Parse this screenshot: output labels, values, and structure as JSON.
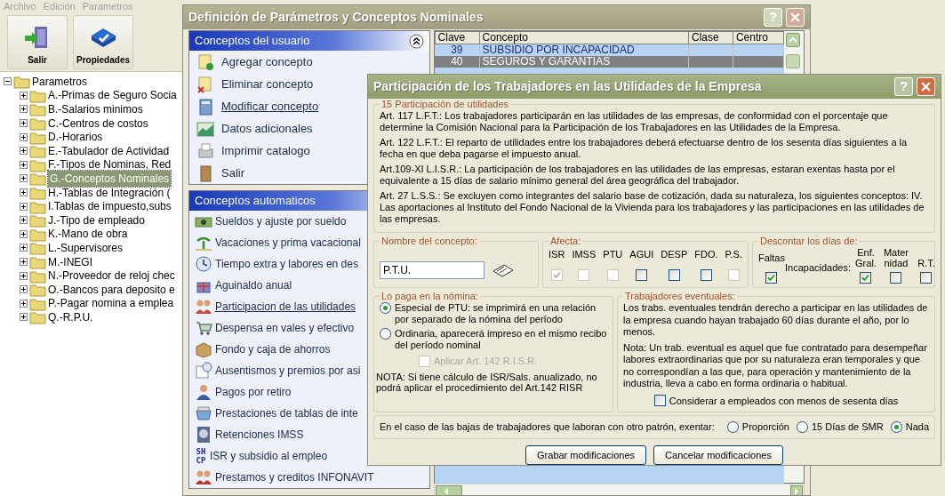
{
  "app": {
    "menu": [
      "Archivo",
      "Edición",
      "Parametros"
    ],
    "toolbar": [
      {
        "label": "Salir"
      },
      {
        "label": "Propiedades"
      }
    ],
    "tree": {
      "label": "Parametros",
      "expanded": true,
      "children": [
        {
          "label": "A.-Primas de Seguro Socia",
          "selected": false
        },
        {
          "label": "B.-Salarios minimos",
          "selected": false
        },
        {
          "label": "C.-Centros de costos",
          "selected": false
        },
        {
          "label": "D.-Horarios",
          "selected": false
        },
        {
          "label": "E.-Tabulador de Actividad",
          "selected": false
        },
        {
          "label": "F.-Tipos de Nominas, Red",
          "selected": false
        },
        {
          "label": "G.-Conceptos Nominales",
          "selected": true
        },
        {
          "label": "H.-Tablas de Integración (",
          "selected": false
        },
        {
          "label": "I.Tablas de impuesto,subs",
          "selected": false
        },
        {
          "label": "J.-Tipo de empleado",
          "selected": false
        },
        {
          "label": "K.-Mano de obra",
          "selected": false
        },
        {
          "label": "L.-Supervisores",
          "selected": false
        },
        {
          "label": "M.-INEGI",
          "selected": false
        },
        {
          "label": "N.-Proveedor de reloj chec",
          "selected": false
        },
        {
          "label": "O.-Bancos para deposito e",
          "selected": false
        },
        {
          "label": "P.-Pagar nomina a emplea",
          "selected": false
        },
        {
          "label": "Q.-R.P.U.",
          "selected": false
        }
      ]
    }
  },
  "back_window": {
    "title": "Definición de Parámetros y Conceptos Nominales",
    "help": "?",
    "user_panel": {
      "title": "Conceptos del usuario",
      "items": [
        {
          "label": "Agregar concepto",
          "hover": false
        },
        {
          "label": "Eliminar concepto",
          "hover": false
        },
        {
          "label": "Modificar concepto",
          "hover": true
        },
        {
          "label": "Datos adicionales",
          "hover": false
        },
        {
          "label": "Imprimir catalogo",
          "hover": false
        },
        {
          "label": "Salir",
          "hover": false
        }
      ]
    },
    "auto_panel": {
      "title": "Conceptos automaticos",
      "items": [
        {
          "label": "Sueldos y ajuste por sueldo",
          "hover": false
        },
        {
          "label": "Vacaciones y prima vacacional",
          "hover": false
        },
        {
          "label": "Tiempo extra y labores en des",
          "hover": false
        },
        {
          "label": "Aguinaldo anual",
          "hover": false
        },
        {
          "label": "Participacion de las utilidades",
          "hover": true
        },
        {
          "label": "Despensa en vales y efectivo",
          "hover": false
        },
        {
          "label": "Fondo y caja de ahorros",
          "hover": false
        },
        {
          "label": "Ausentismos y premios por asi",
          "hover": false
        },
        {
          "label": "Pagos por retiro",
          "hover": false
        },
        {
          "label": "Prestaciones de tablas de inte",
          "hover": false
        },
        {
          "label": "Retenciones IMSS",
          "hover": false
        },
        {
          "label": "ISR y subsidio al empleo",
          "hover": false,
          "icon_text": "SH CP"
        },
        {
          "label": "Prestamos y creditos INFONAVIT",
          "hover": false
        }
      ]
    },
    "grid": {
      "columns": [
        "Clave",
        "Concepto",
        "Clase",
        "Centro"
      ],
      "rows": [
        {
          "cells": [
            "39",
            "SUBSIDIO POR INCAPACIDAD",
            "",
            ""
          ],
          "selected": false
        },
        {
          "cells": [
            "40",
            "SEGUROS Y GARANTIAS",
            "",
            ""
          ],
          "selected": true
        }
      ]
    }
  },
  "dialog": {
    "title": "Participación de los Trabajadores en las Utilidades de la Empresa",
    "help": "?",
    "info": {
      "legend": "15 Participación de utilidades",
      "paragraphs": [
        "Art. 117 L.F.T.: Los trabajadores participarán en las utilidades de las empresas, de conformidad con el porcentaje que determine la Comisión Nacional para la Participación de los Trabajadores en las Utilidades de la Empresa.",
        "Art. 122 L.F.T.: El reparto de utilidades entre los trabajadores deberá efectuarse dentro de los sesenta días siguientes a la fecha en que deba pagarse el impuesto anual.",
        "Art.109-XI L.I.S.R.: La participación de los trabajadores en las utilidades de las empresas, estaran exentas hasta por el equivalente a 15 días de salario mínimo general del área geográfica del trabajador.",
        "Art. 27 L.S.S.: Se excluyen como integrantes del salario base de cotización, dada su naturaleza, los siguientes conceptos: IV. Las aportaciones al Instituto del Fondo Nacional de la Vivienda para los trabajadores y las participaciones en las utilidades de las empresas."
      ]
    },
    "name_group": {
      "legend": "Nombre del concepto:",
      "value": "P.T.U."
    },
    "afecta": {
      "legend": "Afecta:",
      "items": [
        {
          "label": "ISR",
          "checked": true,
          "disabled": true
        },
        {
          "label": "IMSS",
          "checked": false,
          "disabled": true
        },
        {
          "label": "PTU",
          "checked": false,
          "disabled": true
        },
        {
          "label": "AGUI",
          "checked": false,
          "disabled": false
        },
        {
          "label": "DESP",
          "checked": false,
          "disabled": false
        },
        {
          "label": "FDO.",
          "checked": false,
          "disabled": false
        },
        {
          "label": "P.S.",
          "checked": false,
          "disabled": true
        }
      ]
    },
    "descontar": {
      "legend": "Descontar los días de:",
      "faltas": {
        "label": "Faltas",
        "checked": true
      },
      "incapacidades": "Incapacidades:",
      "items": [
        {
          "label": "Enf. Gral.",
          "checked": true
        },
        {
          "label": "Mater nidad",
          "checked": false
        },
        {
          "label": "R.T.",
          "checked": false
        }
      ]
    },
    "paga": {
      "legend": "Lo paga en la nómina:",
      "options": [
        {
          "label": "Especial de PTU: se imprimirá en una relación por separado de la nómina del período",
          "selected": true
        },
        {
          "label": "Ordinaria, aparecerá impreso en el mismo recibo del período nominal",
          "selected": false
        }
      ],
      "aplicar": {
        "label": "Aplicar Art. 142 R.I.S.R.",
        "checked": false,
        "disabled": true
      },
      "note": "NOTA: Si tiene cálculo de ISR/Sals. anualizado, no podrá aplicar el procedimiento del Art.142 RISR"
    },
    "eventuales": {
      "legend": "Trabajadores eventuales:",
      "paragraphs": [
        "Los trabs. eventuales tendrán derecho a participar en las utilidades de la empresa cuando hayan trabajado 60 días durante el año, por lo menos.",
        "Nota: Un trab. eventual es aquel que fue contratado para desempeñar labores extraordinarias que por su naturaleza eran temporales y que no correspondían a las que, para operación y mantenimiento de la industria, lleva a cabo en forma ordinaria o habitual."
      ],
      "consider": {
        "label": "Considerar a empleados con menos de sesenta días",
        "checked": false
      }
    },
    "exentar": {
      "label": "En el caso de las bajas de trabajadores que laboran con otro patrón, exentar:",
      "options": [
        {
          "label": "Proporción",
          "selected": false
        },
        {
          "label": "15 Días de SMR",
          "selected": false
        },
        {
          "label": "Nada",
          "selected": true
        }
      ]
    },
    "buttons": [
      "Grabar modificaciones",
      "Cancelar modificaciones"
    ]
  }
}
